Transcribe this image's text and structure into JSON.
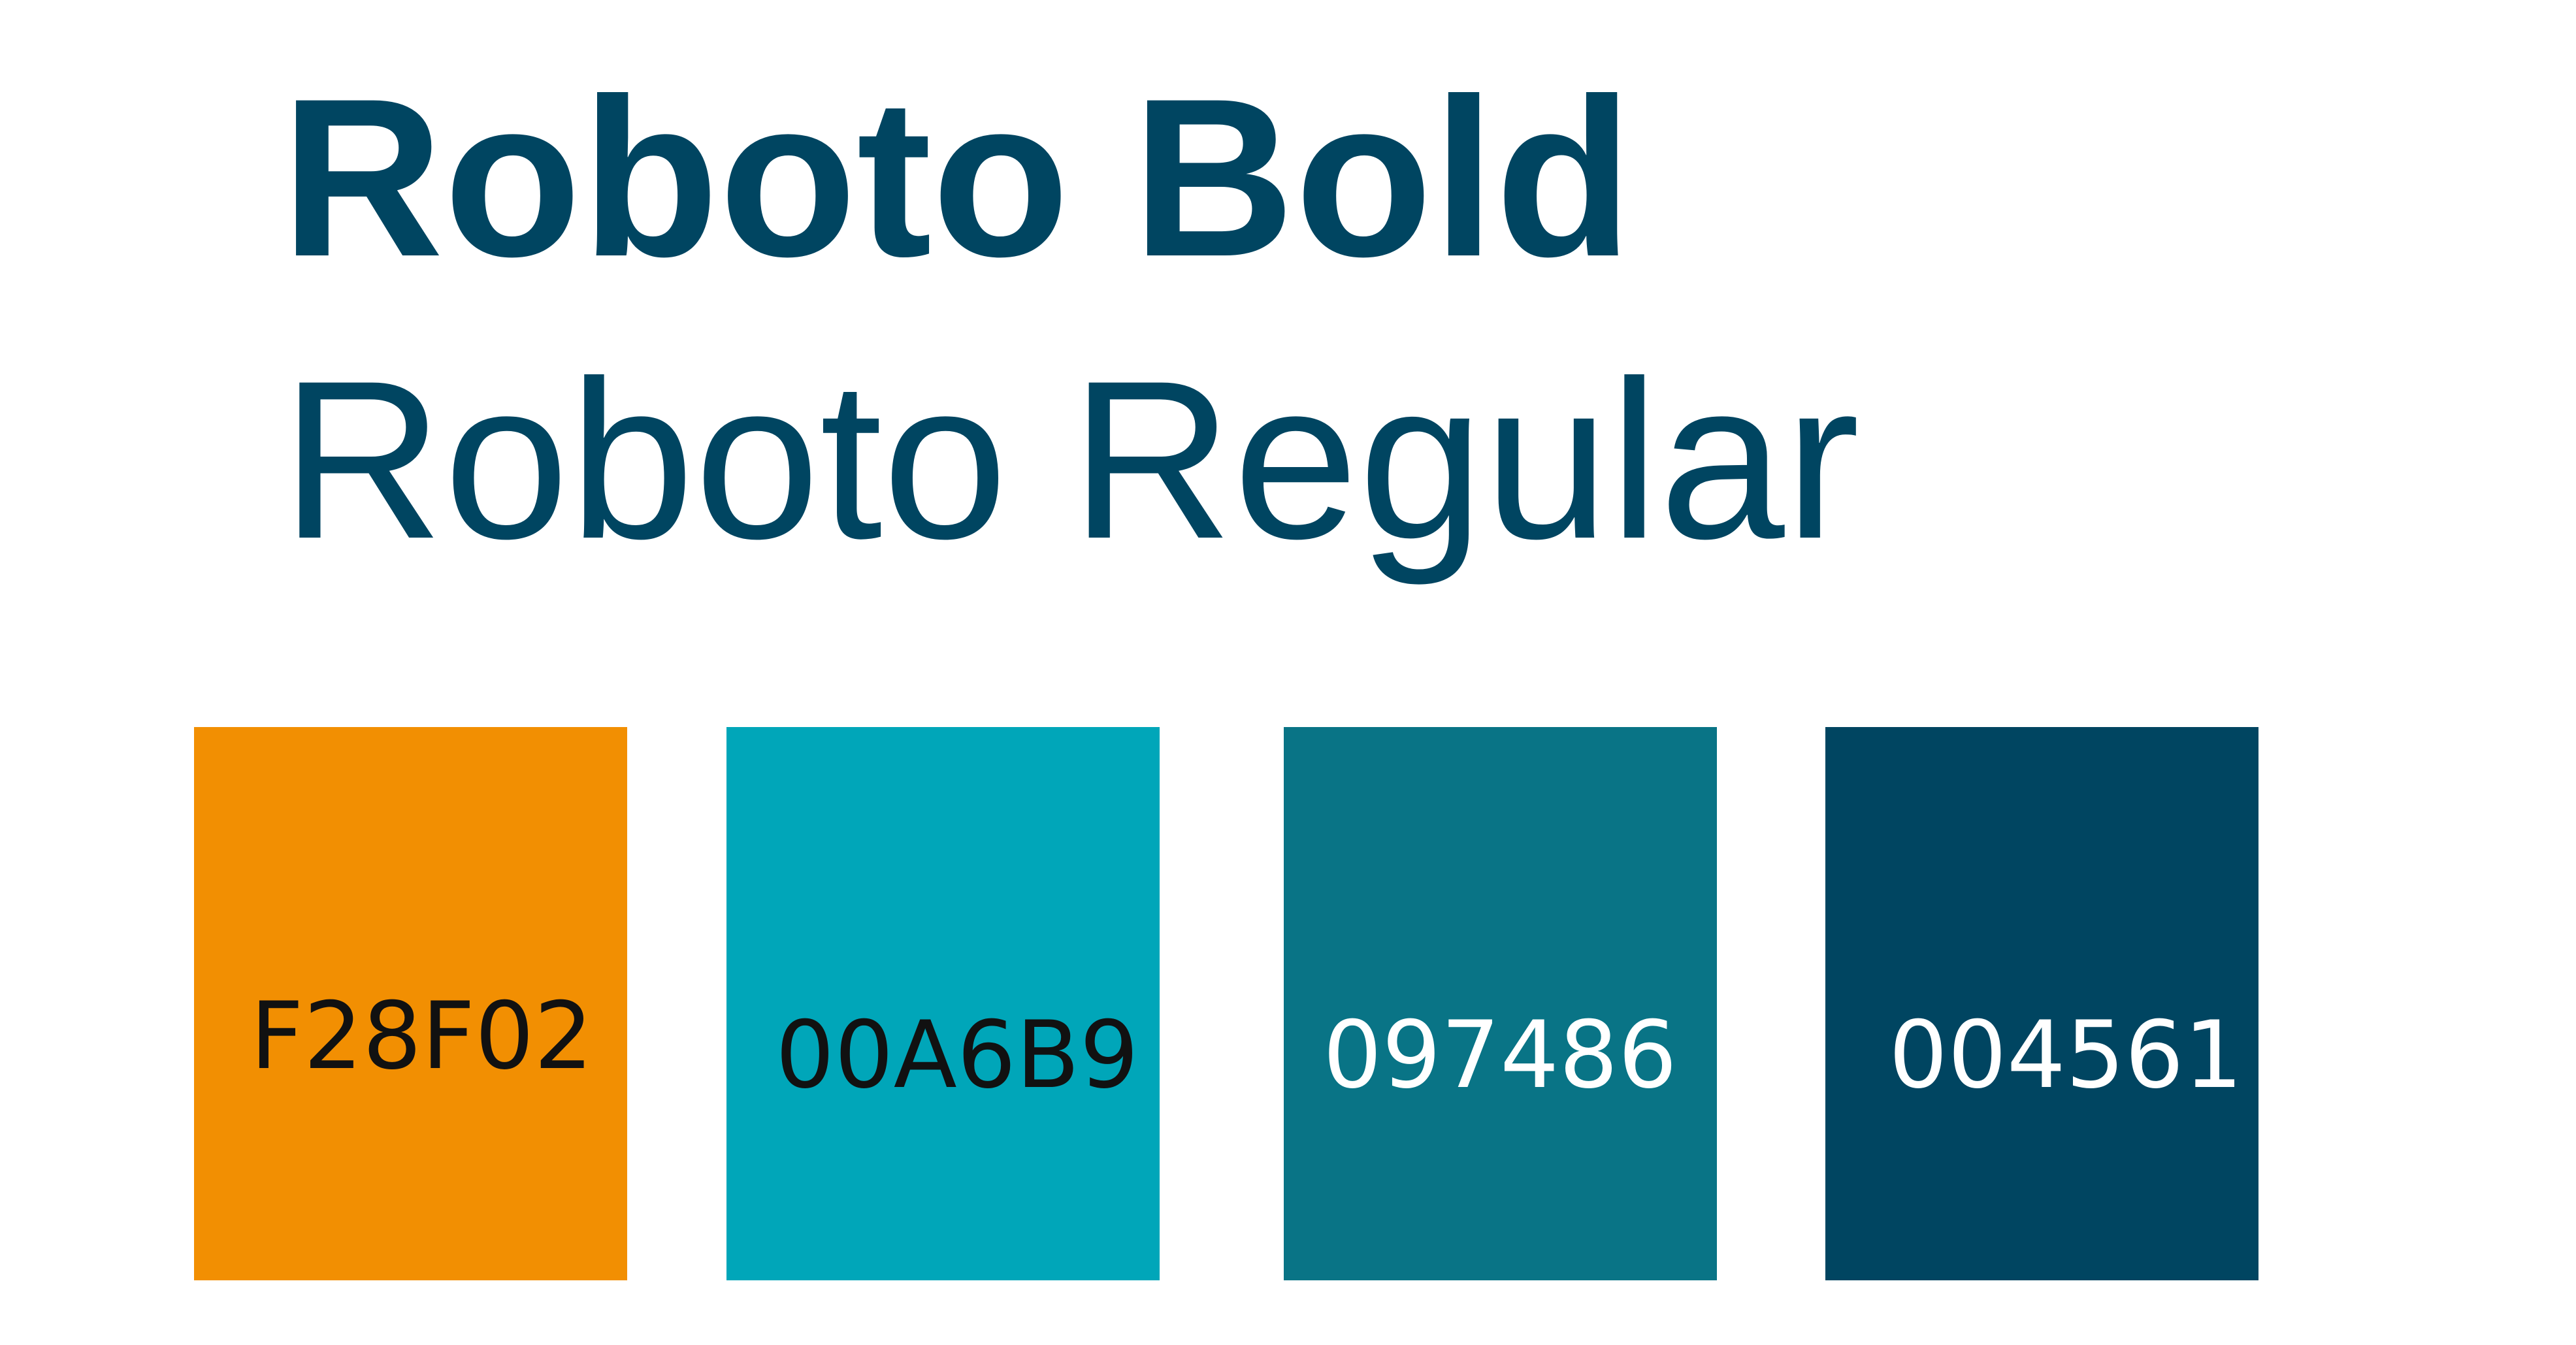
{
  "fonts": {
    "bold_label": "Roboto Bold",
    "regular_label": "Roboto Regular",
    "text_color": "#004561"
  },
  "palette": [
    {
      "hex_label": "F28F02",
      "color": "#F28F02",
      "text_color": "#111111"
    },
    {
      "hex_label": "00A6B9",
      "color": "#00A6B9",
      "text_color": "#111111"
    },
    {
      "hex_label": "097486",
      "color": "#097486",
      "text_color": "#FFFFFF"
    },
    {
      "hex_label": "004561",
      "color": "#004561",
      "text_color": "#FFFFFF"
    }
  ]
}
